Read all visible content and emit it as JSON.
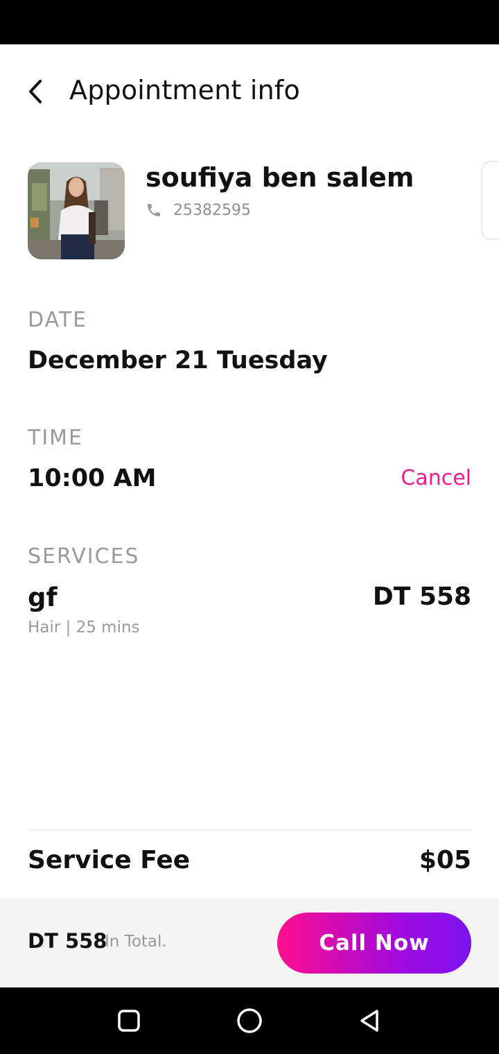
{
  "header": {
    "title": "Appointment info"
  },
  "customer": {
    "name": "soufiya ben salem",
    "phone": "25382595"
  },
  "date": {
    "label": "DATE",
    "value": "December 21 Tuesday"
  },
  "time": {
    "label": "TIME",
    "value": "10:00 AM",
    "cancel_label": "Cancel"
  },
  "services": {
    "label": "SERVICES",
    "items": [
      {
        "name": "gf",
        "price": "DT 558",
        "meta": "Hair | 25 mins"
      }
    ]
  },
  "fee": {
    "label": "Service Fee",
    "value": "$05"
  },
  "footer": {
    "total": "DT 558",
    "total_suffix": "In Total.",
    "call_label": "Call Now"
  },
  "colors": {
    "accent": "#ee1c8e",
    "button_gradient_start": "#ff0f8f",
    "button_gradient_end": "#7e14f2"
  },
  "icons": [
    "back-arrow-icon",
    "phone-icon",
    "nav-recents-icon",
    "nav-home-icon",
    "nav-back-icon"
  ]
}
